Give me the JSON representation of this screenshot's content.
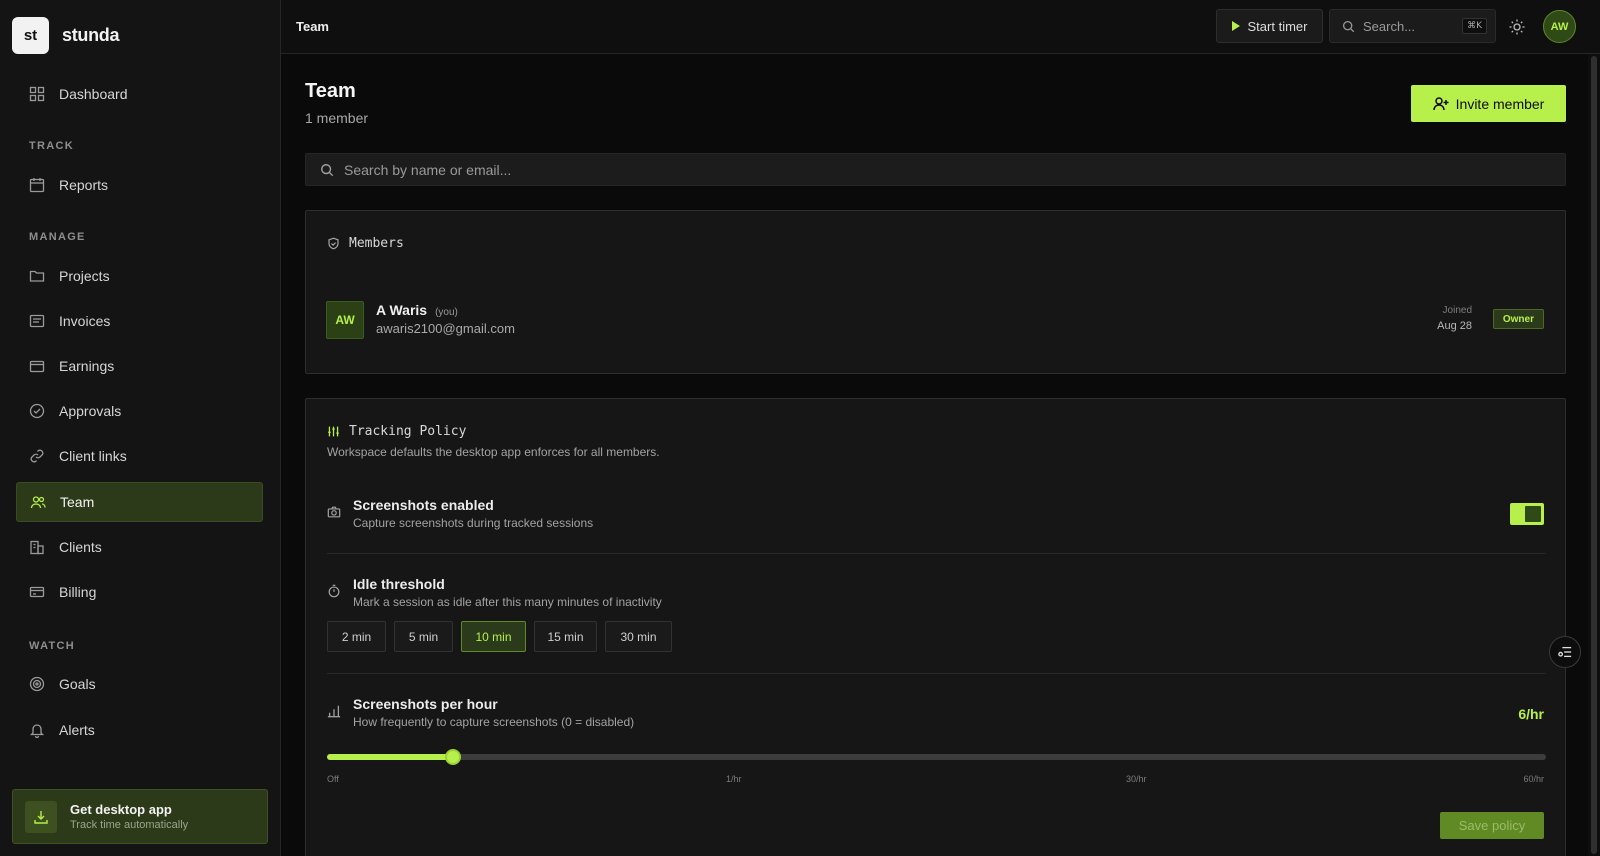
{
  "app": {
    "logo_mark": "st",
    "name": "stunda"
  },
  "sidebar": {
    "dashboard": "Dashboard",
    "sections": {
      "track": "TRACK",
      "manage": "MANAGE",
      "watch": "WATCH"
    },
    "items": [
      {
        "label": "Reports",
        "icon": "calendar-icon"
      },
      {
        "label": "Projects",
        "icon": "folder-icon"
      },
      {
        "label": "Invoices",
        "icon": "invoice-icon"
      },
      {
        "label": "Earnings",
        "icon": "wallet-icon"
      },
      {
        "label": "Approvals",
        "icon": "check-badge-icon"
      },
      {
        "label": "Client links",
        "icon": "link-icon"
      },
      {
        "label": "Team",
        "icon": "users-icon",
        "active": true
      },
      {
        "label": "Clients",
        "icon": "building-icon"
      },
      {
        "label": "Billing",
        "icon": "card-icon"
      },
      {
        "label": "Goals",
        "icon": "target-icon"
      },
      {
        "label": "Alerts",
        "icon": "bell-icon"
      }
    ],
    "desktop_app": {
      "title": "Get desktop app",
      "subtitle": "Track time automatically"
    }
  },
  "topbar": {
    "breadcrumb": "Team",
    "start_timer": "Start timer",
    "search_placeholder": "Search...",
    "search_shortcut": "⌘K",
    "avatar_initials": "AW"
  },
  "page": {
    "title": "Team",
    "subtitle": "1 member",
    "invite_label": "Invite member",
    "search_placeholder": "Search by name or email..."
  },
  "members": {
    "heading": "Members",
    "list": [
      {
        "initials": "AW",
        "name": "A Waris",
        "you_tag": "(you)",
        "email": "awaris2100@gmail.com",
        "joined_label": "Joined",
        "joined_date": "Aug 28",
        "role": "Owner"
      }
    ]
  },
  "policy": {
    "heading": "Tracking Policy",
    "description": "Workspace defaults the desktop app enforces for all members.",
    "screenshots": {
      "title": "Screenshots enabled",
      "description": "Capture screenshots during tracked sessions",
      "enabled": true
    },
    "idle": {
      "title": "Idle threshold",
      "description": "Mark a session as idle after this many minutes of inactivity",
      "options": [
        "2 min",
        "5 min",
        "10 min",
        "15 min",
        "30 min"
      ],
      "selected": "10 min"
    },
    "per_hour": {
      "title": "Screenshots per hour",
      "description": "How frequently to capture screenshots (0 = disabled)",
      "value_label": "6/hr",
      "fill_fraction": 0.103,
      "ticks": [
        "Off",
        "1/hr",
        "30/hr",
        "60/hr"
      ]
    },
    "save_label": "Save policy"
  },
  "colors": {
    "accent": "#b7f04a",
    "active_bg": "#2c3a1a",
    "background": "#0a0a0a"
  }
}
